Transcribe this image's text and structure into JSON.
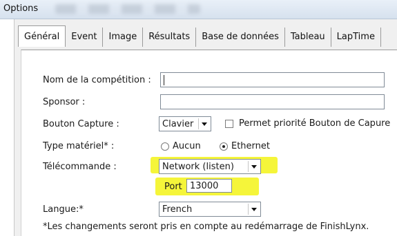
{
  "window": {
    "title": "Options"
  },
  "tabs": [
    {
      "label": "Général"
    },
    {
      "label": "Event"
    },
    {
      "label": "Image"
    },
    {
      "label": "Résultats"
    },
    {
      "label": "Base de données"
    },
    {
      "label": "Tableau"
    },
    {
      "label": "LapTime"
    }
  ],
  "form": {
    "competition_label": "Nom de la compétition :",
    "competition_value": "",
    "sponsor_label": "Sponsor :",
    "sponsor_value": "",
    "capture_label": "Bouton Capture :",
    "capture_value": "Clavier",
    "capture_priority_label": "Permet priorité Bouton de Capure",
    "hardware_label": "Type matériel* :",
    "hardware_option_none": "Aucun",
    "hardware_option_ethernet": "Ethernet",
    "hardware_selected": "Ethernet",
    "remote_label": "Télécommande :",
    "remote_value": "Network (listen)",
    "port_label": "Port",
    "port_value": "13000",
    "language_label": "Langue:*",
    "language_value": "French",
    "footnote": "*Les changements seront pris en compte au redémarrage de FinishLynx."
  },
  "colors": {
    "highlight": "#f5f53a",
    "titlebar": "#dfe7f1"
  },
  "icons": {
    "combo_arrow": "chevron-down-icon",
    "checkbox": "checkbox-icon",
    "radio": "radio-icon"
  }
}
